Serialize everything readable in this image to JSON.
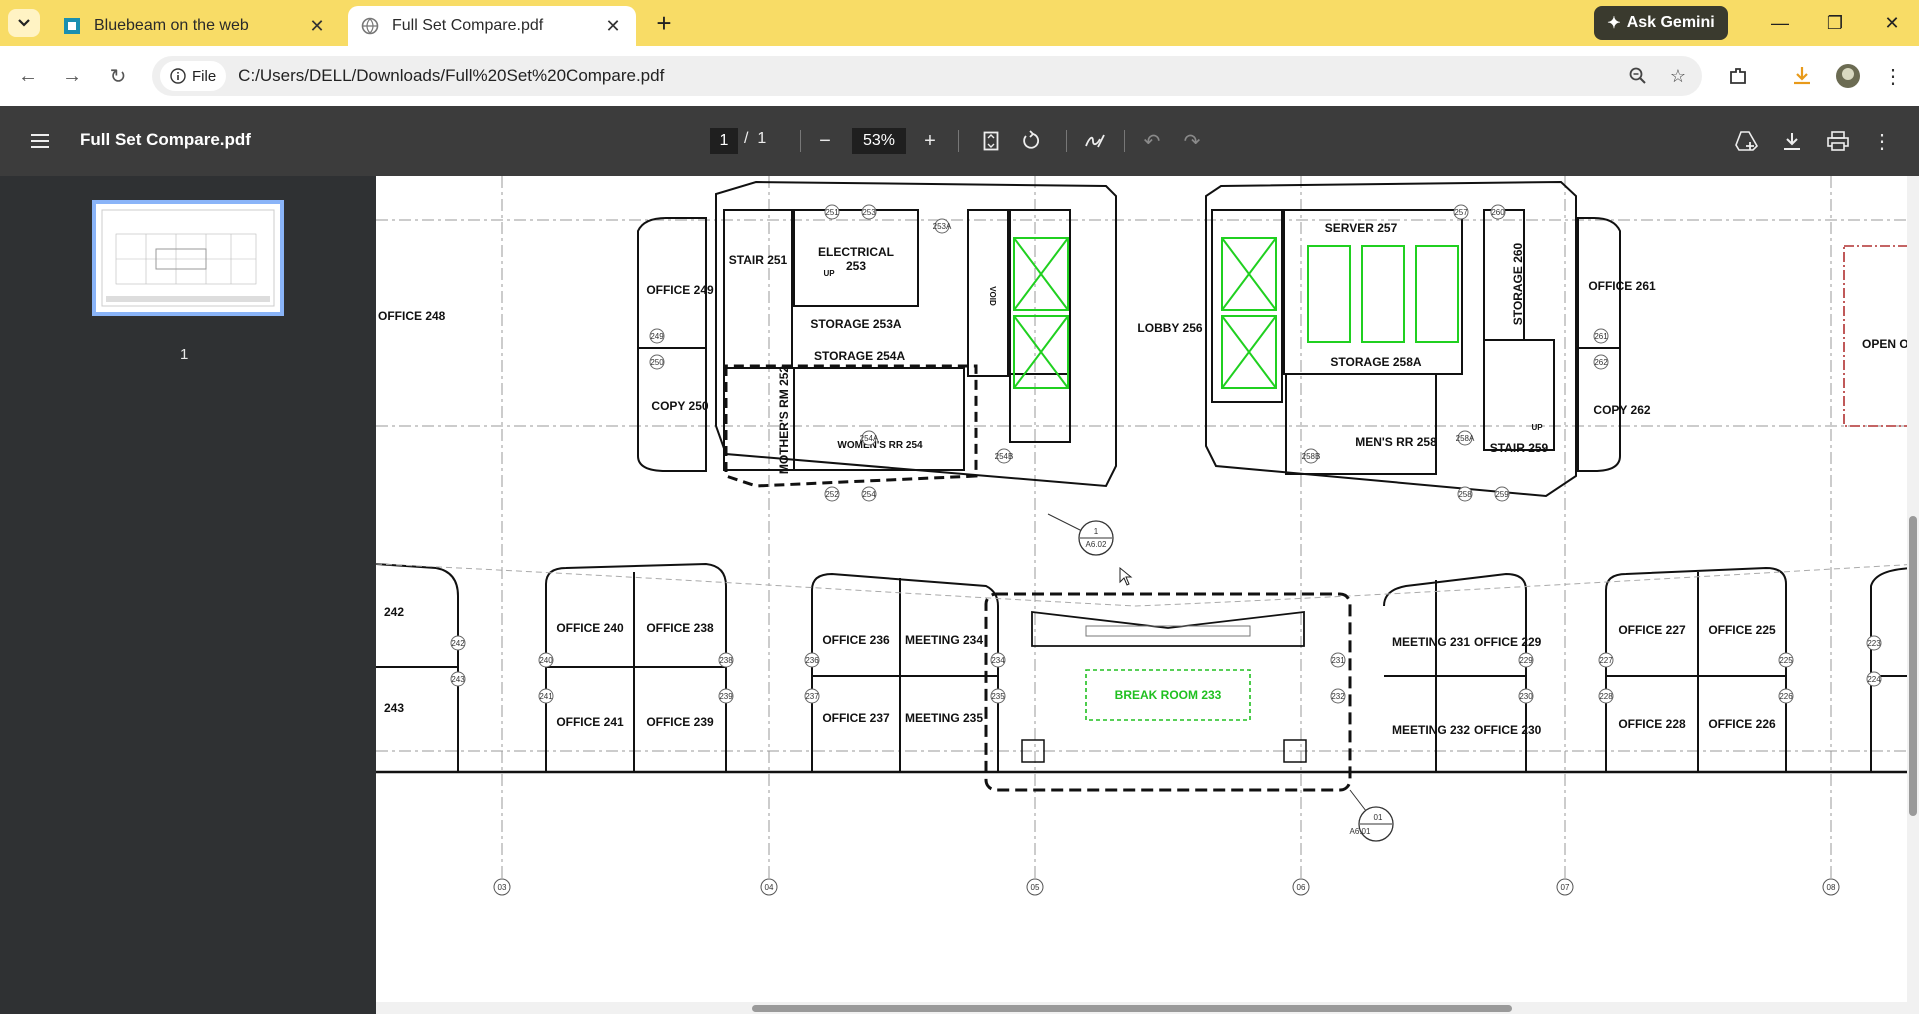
{
  "browser": {
    "tabs": [
      {
        "title": "Bluebeam on the web",
        "icon": "bluebeam-icon"
      },
      {
        "title": "Full Set Compare.pdf",
        "icon": "globe-icon",
        "active": true
      }
    ],
    "ask_gemini": "Ask Gemini",
    "address": {
      "chip": "File",
      "url": "C:/Users/DELL/Downloads/Full%20Set%20Compare.pdf"
    }
  },
  "viewer": {
    "doc_title": "Full Set Compare.pdf",
    "page_current": "1",
    "page_sep": "/",
    "page_total": "1",
    "zoom": "53%",
    "thumbnail_label": "1"
  },
  "plan": {
    "rooms_upper": [
      "OFFICE 248",
      "OFFICE 249",
      "COPY 250",
      "STAIR 251",
      "ELECTRICAL",
      "253",
      "STORAGE 253A",
      "STORAGE 254A",
      "MOTHER'S RM 252",
      "WOMEN'S RR 254",
      "VOID",
      "LOBBY 256",
      "SERVER 257",
      "STORAGE 258A",
      "MEN'S RR 258",
      "STORAGE 260",
      "STAIR 259",
      "OFFICE 261",
      "COPY 262",
      "OPEN OI",
      "UP",
      "UP"
    ],
    "rooms_lower": [
      "242",
      "243",
      "OFFICE 240",
      "OFFICE 238",
      "OFFICE 241",
      "OFFICE 239",
      "OFFICE 236",
      "MEETING 234",
      "OFFICE 237",
      "MEETING 235",
      "BREAK ROOM 233",
      "MEETING 231",
      "OFFICE 229",
      "MEETING 232",
      "OFFICE 230",
      "OFFICE 227",
      "OFFICE 225",
      "OFFICE 228",
      "OFFICE 226"
    ],
    "tags": [
      "251",
      "253",
      "253A",
      "249",
      "250",
      "254A",
      "254B",
      "252",
      "254",
      "257",
      "260",
      "261",
      "262",
      "258B",
      "258A",
      "258",
      "259",
      "242",
      "243",
      "240",
      "241",
      "238",
      "239",
      "236",
      "237",
      "234",
      "235",
      "231",
      "232",
      "229",
      "230",
      "227",
      "228",
      "225",
      "226",
      "223",
      "224"
    ],
    "callouts": [
      {
        "num": "1",
        "sheet": "A6.02"
      },
      {
        "num": "01",
        "sheet": "A6.01"
      }
    ],
    "grid": [
      "03",
      "04",
      "05",
      "06",
      "07",
      "08"
    ]
  }
}
